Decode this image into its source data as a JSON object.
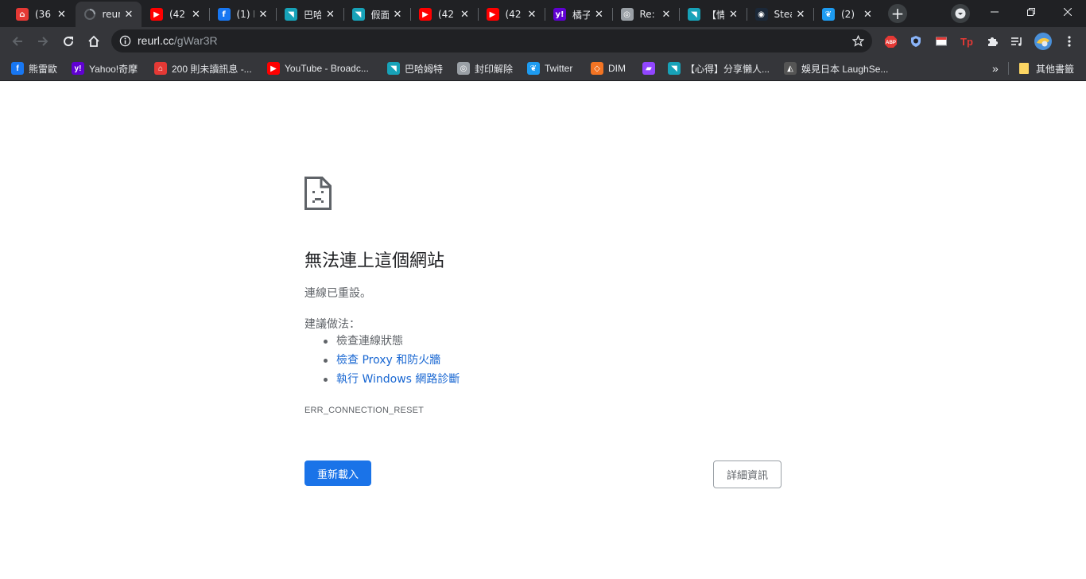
{
  "tabs": [
    {
      "title": "(36",
      "icon": "red-app-icon",
      "color": "#e53935",
      "glyph": "⌂"
    },
    {
      "title": "reur",
      "icon": "loading-icon",
      "color": "#5f6368",
      "glyph": "",
      "active": true
    },
    {
      "title": "(42",
      "icon": "youtube-icon",
      "color": "#ff0000",
      "glyph": "▶"
    },
    {
      "title": "(1) I",
      "icon": "facebook-icon",
      "color": "#1877f2",
      "glyph": "f"
    },
    {
      "title": "巴哈",
      "icon": "bahamut-icon",
      "color": "#17a2b8",
      "glyph": "◥"
    },
    {
      "title": "假面",
      "icon": "bahamut-icon",
      "color": "#17a2b8",
      "glyph": "◥"
    },
    {
      "title": "(42",
      "icon": "youtube-icon",
      "color": "#ff0000",
      "glyph": "▶"
    },
    {
      "title": "(42",
      "icon": "youtube-icon",
      "color": "#ff0000",
      "glyph": "▶"
    },
    {
      "title": "橘子",
      "icon": "yahoo-icon",
      "color": "#6001d2",
      "glyph": "y!"
    },
    {
      "title": "Re:",
      "icon": "globe-icon",
      "color": "#9aa0a6",
      "glyph": "◎"
    },
    {
      "title": "【情",
      "icon": "bahamut-icon",
      "color": "#17a2b8",
      "glyph": "◥"
    },
    {
      "title": "Stea",
      "icon": "steam-icon",
      "color": "#1b2838",
      "glyph": "◉"
    },
    {
      "title": "(2)",
      "icon": "twitter-icon",
      "color": "#1d9bf0",
      "glyph": "❦"
    }
  ],
  "address": {
    "host": "reurl.cc",
    "path": "/gWar3R"
  },
  "bookmarks": [
    {
      "label": "熊雷歐",
      "icon": "facebook-icon",
      "color": "#1877f2",
      "glyph": "f"
    },
    {
      "label": "Yahoo!奇摩",
      "icon": "yahoo-icon",
      "color": "#6001d2",
      "glyph": "y!"
    },
    {
      "label": "200 則未讀訊息 -...",
      "icon": "red-app-icon",
      "color": "#e53935",
      "glyph": "⌂"
    },
    {
      "label": "YouTube - Broadc...",
      "icon": "youtube-icon",
      "color": "#ff0000",
      "glyph": "▶"
    },
    {
      "label": "巴哈姆特",
      "icon": "bahamut-icon",
      "color": "#17a2b8",
      "glyph": "◥"
    },
    {
      "label": "封印解除",
      "icon": "globe-icon",
      "color": "#9aa0a6",
      "glyph": "◎"
    },
    {
      "label": "Twitter",
      "icon": "twitter-icon",
      "color": "#1d9bf0",
      "glyph": "❦"
    },
    {
      "label": "DIM",
      "icon": "dim-icon",
      "color": "#f37423",
      "glyph": "◇"
    },
    {
      "label": "",
      "icon": "twitch-icon",
      "color": "#9146ff",
      "glyph": "▰"
    },
    {
      "label": "【心得】分享懶人...",
      "icon": "bahamut-icon",
      "color": "#17a2b8",
      "glyph": "◥"
    },
    {
      "label": "娛見日本 LaughSe...",
      "icon": "laughseejapan-icon",
      "color": "#555555",
      "glyph": "◭"
    }
  ],
  "other_bookmarks": "其他書籤",
  "error": {
    "title": "無法連上這個網站",
    "description": "連線已重設。",
    "suggestions_heading": "建議做法：",
    "suggestions": [
      {
        "text": "檢查連線狀態",
        "link": false
      },
      {
        "text": "檢查 Proxy 和防火牆",
        "link": true
      },
      {
        "text": "執行 Windows 網路診斷",
        "link": true
      }
    ],
    "code": "ERR_CONNECTION_RESET",
    "reload_label": "重新載入",
    "details_label": "詳細資訊"
  },
  "colors": {
    "accent": "#1a73e8",
    "link": "#1967d2",
    "chrome_dark": "#202124",
    "toolbar": "#35363a"
  }
}
